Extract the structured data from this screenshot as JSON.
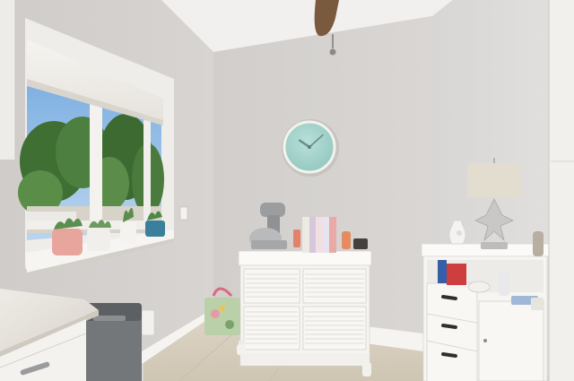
{
  "scene": {
    "kind": "interior-photo",
    "colors": {
      "wall_left": "#d2cfcc",
      "wall_back": "#d6d3d0",
      "wall_right": "#dcdad8",
      "ceiling": "#f1f0ee",
      "floor": "#d8cfbf",
      "cabinet": "#f7f6f3",
      "trim": "#f3f2ef",
      "clock_face": "#a9d6cf",
      "foliage": "#4c7a3c",
      "sky": "#8bb7e3"
    },
    "clock": {
      "hour": 10,
      "minute": 8
    },
    "objects": [
      "window",
      "roller-shade",
      "potted-plants",
      "wall-clock",
      "ceiling-fan-blade",
      "stand-mixer",
      "books",
      "white-cabinet-left",
      "white-cabinet-right",
      "table-lamp",
      "vase",
      "trash-can",
      "tote-bag",
      "countertop",
      "baseboard"
    ]
  }
}
